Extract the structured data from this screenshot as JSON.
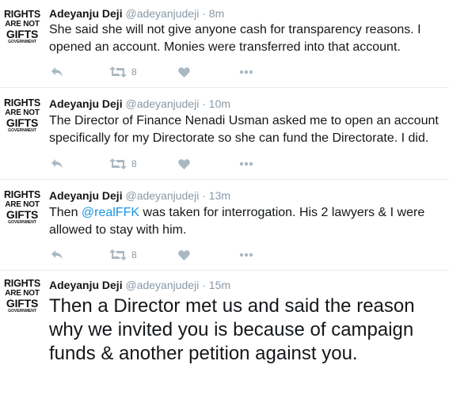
{
  "tweets": [
    {
      "avatar": {
        "line1": "RIGHTS",
        "line2": "ARE NOT",
        "line3": "GIFTS",
        "line4": "GOVERNMENT"
      },
      "name": "Adeyanju Deji",
      "handle": "@adeyanjudeji",
      "separator": "·",
      "time": "8m",
      "text_before": "She said she will not give anyone cash for transparency reasons. I opened an account. Monies were transferred into that account.",
      "mention": "",
      "text_after": "",
      "retweet_count": "8"
    },
    {
      "avatar": {
        "line1": "RIGHTS",
        "line2": "ARE NOT",
        "line3": "GIFTS",
        "line4": "GOVERNMENT"
      },
      "name": "Adeyanju Deji",
      "handle": "@adeyanjudeji",
      "separator": "·",
      "time": "10m",
      "text_before": "The Director of Finance Nenadi Usman asked me to open an account specifically for my Directorate so she can fund the Directorate. I did.",
      "mention": "",
      "text_after": "",
      "retweet_count": "8"
    },
    {
      "avatar": {
        "line1": "RIGHTS",
        "line2": "ARE NOT",
        "line3": "GIFTS",
        "line4": "GOVERNMENT"
      },
      "name": "Adeyanju Deji",
      "handle": "@adeyanjudeji",
      "separator": "·",
      "time": "13m",
      "text_before": "Then ",
      "mention": "@realFFK",
      "text_after": " was taken for interrogation. His 2 lawyers & I were allowed to stay with him.",
      "retweet_count": "8"
    },
    {
      "avatar": {
        "line1": "RIGHTS",
        "line2": "ARE NOT",
        "line3": "GIFTS",
        "line4": "GOVERNMENT"
      },
      "name": "Adeyanju Deji",
      "handle": "@adeyanjudeji",
      "separator": "·",
      "time": "15m",
      "text_before": "Then a Director met us and said the reason why we invited you is because of campaign funds & another petition against you.",
      "mention": "",
      "text_after": "",
      "retweet_count": ""
    }
  ]
}
